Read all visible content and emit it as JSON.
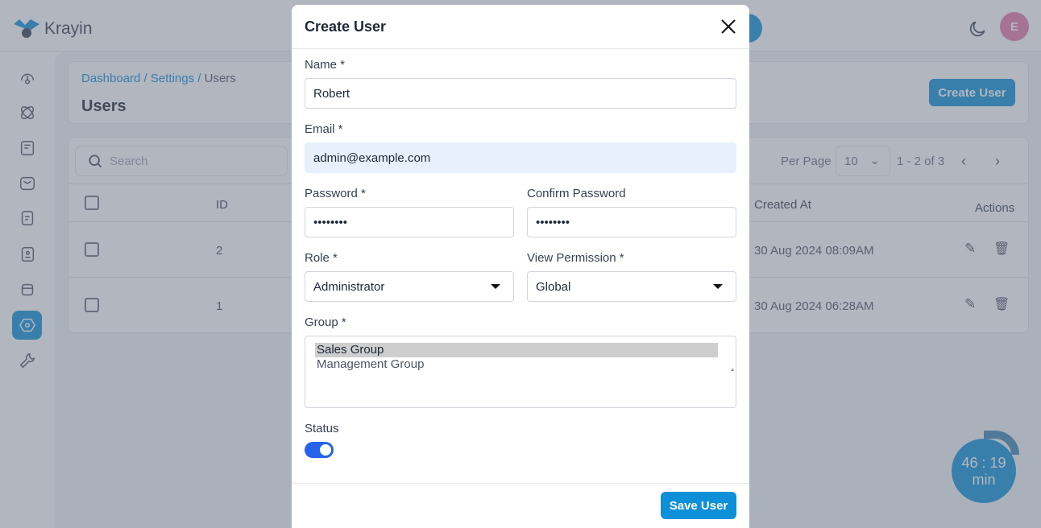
{
  "app": {
    "name": "Krayin",
    "avatar_letter": "E"
  },
  "breadcrumb": {
    "items": [
      "Dashboard",
      "Settings"
    ],
    "current": "Users"
  },
  "page_title": "Users",
  "create_user_label": "Create User",
  "toolbar": {
    "search_placeholder": "Search",
    "per_page_label": "Per Page",
    "per_page_value": "10",
    "pagination": "1 - 2 of 3"
  },
  "table": {
    "headers": {
      "id": "ID",
      "created_at": "Created At",
      "actions": "Actions"
    },
    "rows": [
      {
        "id": "2",
        "created_at": "30 Aug 2024 08:09AM"
      },
      {
        "id": "1",
        "created_at": "30 Aug 2024 06:28AM"
      }
    ]
  },
  "timer": {
    "time": "46 : 19",
    "unit": "min"
  },
  "modal": {
    "title": "Create User",
    "name_label": "Name *",
    "name_value": "Robert",
    "email_label": "Email *",
    "email_value": "admin@example.com",
    "password_label": "Password *",
    "password_value": "••••••••",
    "confirm_label": "Confirm Password",
    "confirm_value": "••••••••",
    "role_label": "Role *",
    "role_value": "Administrator",
    "view_label": "View Permission *",
    "view_value": "Global",
    "group_label": "Group *",
    "groups": [
      "Sales Group",
      "Management Group"
    ],
    "selected_group": "Sales Group",
    "status_label": "Status",
    "status_on": true,
    "save_label": "Save User"
  },
  "colors": {
    "primary": "#0e90d9",
    "toggle": "#2563eb",
    "avatar": "#e879a9"
  }
}
